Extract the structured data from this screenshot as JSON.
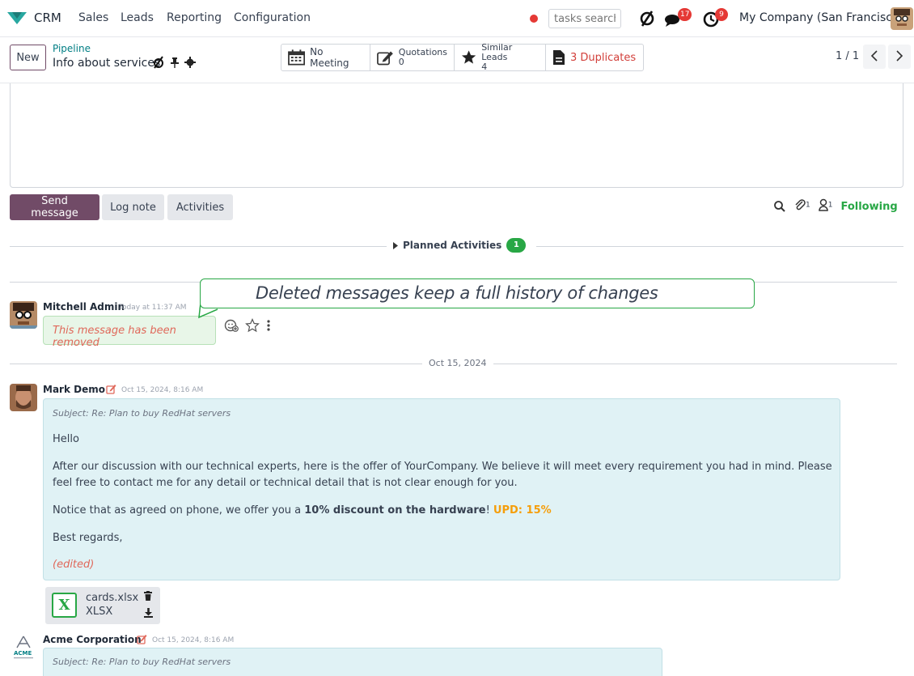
{
  "topnav": {
    "app_name": "CRM",
    "menu": [
      "Sales",
      "Leads",
      "Reporting",
      "Configuration"
    ],
    "search_placeholder": "tasks search",
    "messages_count": "17",
    "activities_count": "9",
    "company": "My Company (San Francisco)"
  },
  "control": {
    "new_label": "New",
    "breadcrumb_parent": "Pipeline",
    "record_title": "Info about services",
    "smart_buttons": {
      "meeting": "No Meeting",
      "quotations_label": "Quotations",
      "quotations_count": "0",
      "similar_label": "Similar Leads",
      "similar_count": "4",
      "duplicates": "3 Duplicates"
    },
    "pager": "1 / 1"
  },
  "chatter": {
    "send_message": "Send message",
    "log_note": "Log note",
    "activities": "Activities",
    "attachments_count": "1",
    "followers_count": "1",
    "following": "Following",
    "planned_activities": "Planned Activities",
    "planned_count": "1"
  },
  "callout": {
    "text": "Deleted messages keep a full history of changes"
  },
  "messages": [
    {
      "author": "Mitchell Admin",
      "time": "Today at 11:37 AM",
      "body": "This message has been removed"
    },
    {
      "date_separator": "Oct 15, 2024",
      "author": "Mark Demo",
      "time": "Oct 15, 2024, 8:16 AM",
      "subject": "Subject: Re: Plan to buy RedHat servers",
      "greeting": "Hello",
      "para1": "After our discussion with our technical experts, here is the offer of YourCompany. We believe it will meet every requirement you had in mind. Please feel free to contact me for any detail or technical detail that is not clear enough for you.",
      "para2_prefix": "Notice that as agreed on phone, we offer you a ",
      "para2_bold": "10% discount on the hardware",
      "para2_suffix": "! ",
      "para2_update": "UPD: 15%",
      "closing": "Best regards,",
      "edited": "(edited)",
      "attachment": {
        "name": "cards.xlsx",
        "type": "XLSX"
      }
    },
    {
      "author": "Acme Corporation",
      "time": "Oct 15, 2024, 8:16 AM",
      "subject": "Subject: Re: Plan to buy RedHat servers"
    }
  ],
  "colors": {
    "brand": "#714b67",
    "success": "#28a745",
    "danger": "#e53935",
    "mail_bubble": "#e0f2f5",
    "note_bubble": "#e8f6e8"
  }
}
